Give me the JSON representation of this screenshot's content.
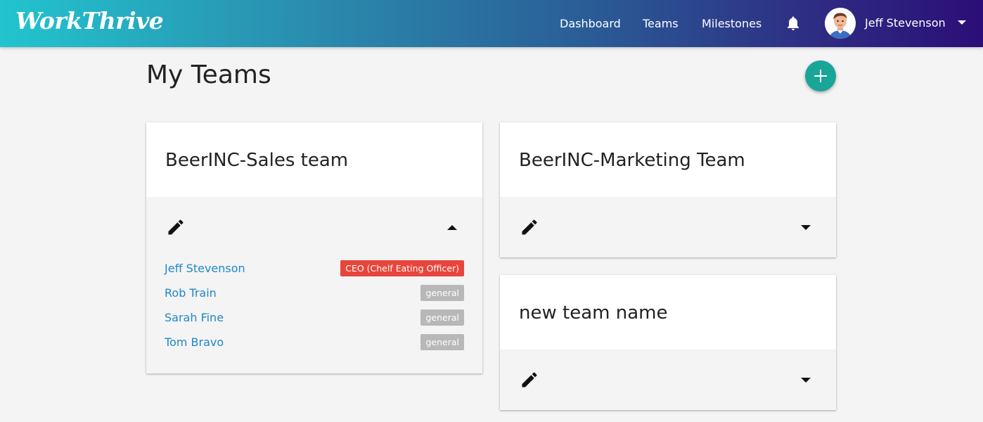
{
  "nav": {
    "logo": "WorkThrive",
    "links": [
      "Dashboard",
      "Teams",
      "Milestones"
    ],
    "user_name": "Jeff Stevenson",
    "icons": {
      "notifications": "bell-icon",
      "menu": "caret-down-icon"
    }
  },
  "page": {
    "title": "My Teams",
    "add_icon": "plus-icon"
  },
  "teams": [
    {
      "name": "BeerINC-Sales team",
      "expanded": true,
      "members": [
        {
          "name": "Jeff Stevenson",
          "role": "CEO (Chelf Eating Officer)",
          "role_type": "ceo"
        },
        {
          "name": "Rob Train",
          "role": "general",
          "role_type": "general"
        },
        {
          "name": "Sarah Fine",
          "role": "general",
          "role_type": "general"
        },
        {
          "name": "Tom Bravo",
          "role": "general",
          "role_type": "general"
        }
      ]
    },
    {
      "name": "BeerINC-Marketing Team",
      "expanded": false,
      "members": []
    },
    {
      "name": "new team name",
      "expanded": false,
      "members": []
    }
  ],
  "colors": {
    "nav_gradient_start": "#22c4cf",
    "nav_gradient_end": "#2b0e77",
    "fab": "#1aa599",
    "member_link": "#1e88c8",
    "badge_ceo": "#e8453c",
    "badge_general": "#b8b8b8",
    "background": "#f4f4f4"
  }
}
